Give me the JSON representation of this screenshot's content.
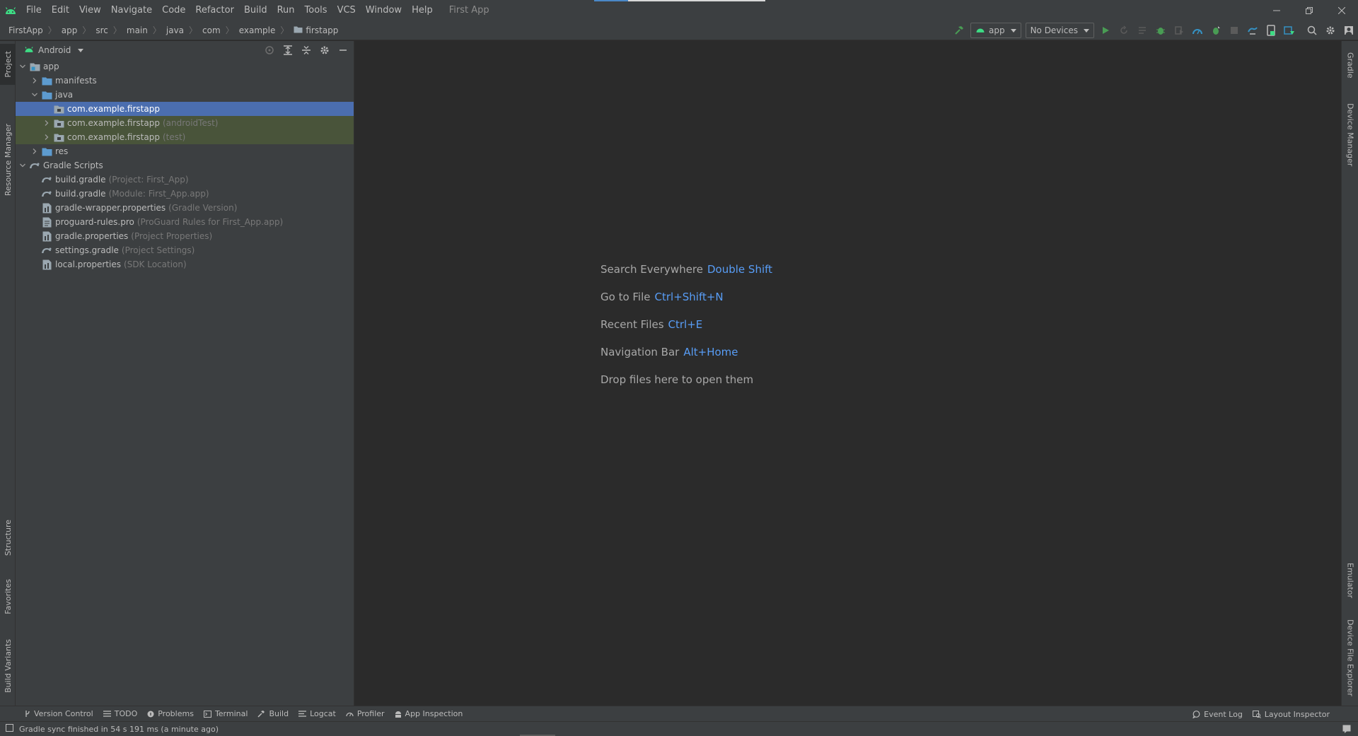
{
  "window": {
    "title": "First App",
    "menu": [
      "File",
      "Edit",
      "View",
      "Navigate",
      "Code",
      "Refactor",
      "Build",
      "Run",
      "Tools",
      "VCS",
      "Window",
      "Help"
    ]
  },
  "breadcrumbs": [
    "FirstApp",
    "app",
    "src",
    "main",
    "java",
    "com",
    "example",
    "firstapp"
  ],
  "toolbar": {
    "run_config": "app",
    "device": "No Devices"
  },
  "left_tabs": [
    "Project",
    "Resource Manager",
    "Structure",
    "Favorites",
    "Build Variants"
  ],
  "right_tabs": [
    "Gradle",
    "Device Manager",
    "Emulator",
    "Device File Explorer"
  ],
  "project_panel": {
    "view_name": "Android",
    "tree": [
      {
        "label": "app",
        "hint": "",
        "icon": "module-folder-icon",
        "depth": 0,
        "expanded": true
      },
      {
        "label": "manifests",
        "hint": "",
        "icon": "folder-icon",
        "depth": 1,
        "expanded": false
      },
      {
        "label": "java",
        "hint": "",
        "icon": "source-folder-icon",
        "depth": 1,
        "expanded": true
      },
      {
        "label": "com.example.firstapp",
        "hint": "",
        "icon": "package-icon",
        "depth": 2,
        "expanded": null,
        "selected": true
      },
      {
        "label": "com.example.firstapp",
        "hint": "(androidTest)",
        "icon": "package-icon",
        "depth": 2,
        "expanded": false,
        "test": true
      },
      {
        "label": "com.example.firstapp",
        "hint": "(test)",
        "icon": "package-icon",
        "depth": 2,
        "expanded": false,
        "test": true
      },
      {
        "label": "res",
        "hint": "",
        "icon": "folder-icon",
        "depth": 1,
        "expanded": false
      },
      {
        "label": "Gradle Scripts",
        "hint": "",
        "icon": "gradle-icon",
        "depth": 0,
        "expanded": true
      },
      {
        "label": "build.gradle",
        "hint": "(Project: First_App)",
        "icon": "gradle-icon",
        "depth": 1,
        "expanded": null
      },
      {
        "label": "build.gradle",
        "hint": "(Module: First_App.app)",
        "icon": "gradle-icon",
        "depth": 1,
        "expanded": null
      },
      {
        "label": "gradle-wrapper.properties",
        "hint": "(Gradle Version)",
        "icon": "properties-file-icon",
        "depth": 1,
        "expanded": null
      },
      {
        "label": "proguard-rules.pro",
        "hint": "(ProGuard Rules for First_App.app)",
        "icon": "text-file-icon",
        "depth": 1,
        "expanded": null
      },
      {
        "label": "gradle.properties",
        "hint": "(Project Properties)",
        "icon": "properties-file-icon",
        "depth": 1,
        "expanded": null
      },
      {
        "label": "settings.gradle",
        "hint": "(Project Settings)",
        "icon": "gradle-icon",
        "depth": 1,
        "expanded": null
      },
      {
        "label": "local.properties",
        "hint": "(SDK Location)",
        "icon": "properties-file-icon",
        "depth": 1,
        "expanded": null
      }
    ]
  },
  "editor_empty": {
    "hints": [
      {
        "text": "Search Everywhere",
        "key": "Double Shift"
      },
      {
        "text": "Go to File",
        "key": "Ctrl+Shift+N"
      },
      {
        "text": "Recent Files",
        "key": "Ctrl+E"
      },
      {
        "text": "Navigation Bar",
        "key": "Alt+Home"
      },
      {
        "text": "Drop files here to open them",
        "key": ""
      }
    ]
  },
  "bottom_tabs": {
    "left": [
      "Version Control",
      "TODO",
      "Problems",
      "Terminal",
      "Build",
      "Logcat",
      "Profiler",
      "App Inspection"
    ],
    "right": [
      "Event Log",
      "Layout Inspector"
    ]
  },
  "status": {
    "message": "Gradle sync finished in 54 s 191 ms (a minute ago)"
  },
  "colors": {
    "background": "#2b2b2b",
    "panel": "#3c3f41",
    "selection": "#4b6eaf",
    "test_row": "#49543a",
    "shortcut": "#589df6",
    "android_green": "#3ddc84"
  }
}
